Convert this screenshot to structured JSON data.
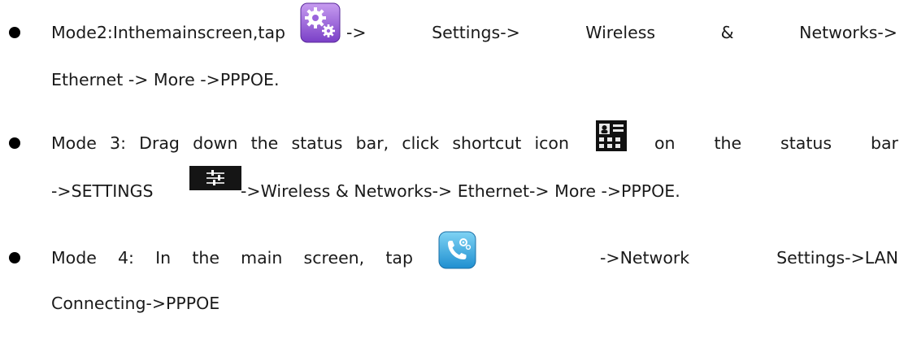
{
  "items": [
    {
      "line1": [
        "Mode",
        "2:",
        "In",
        "the",
        "main",
        "screen,",
        "tap"
      ],
      "line1_after_icon": [
        "->",
        "Settings->",
        "Wireless",
        "&",
        "Networks->"
      ],
      "line2": "Ethernet -> More ->PPPOE.",
      "icon": "purple-gears-settings-icon"
    },
    {
      "line1": [
        "Mode",
        "3:",
        "Drag",
        "down",
        "the",
        "status",
        "bar,",
        "click",
        "shortcut",
        "icon"
      ],
      "line1_after_icon": [
        "on",
        "the",
        "status",
        "bar"
      ],
      "line2_prefix": "->SETTINGS",
      "line2_suffix": "->Wireless & Networks-> Ethernet-> More ->PPPOE.",
      "icon": "status-bar-shortcut-icon",
      "icon2": "settings-sliders-icon"
    },
    {
      "line1": [
        "Mode",
        "4:",
        "In",
        "the",
        "main",
        "screen,",
        "tap"
      ],
      "line1_after_icon": [
        "->Network",
        "Settings->LAN"
      ],
      "line2": "Connecting->PPPOE",
      "icon": "phone-settings-icon"
    }
  ]
}
